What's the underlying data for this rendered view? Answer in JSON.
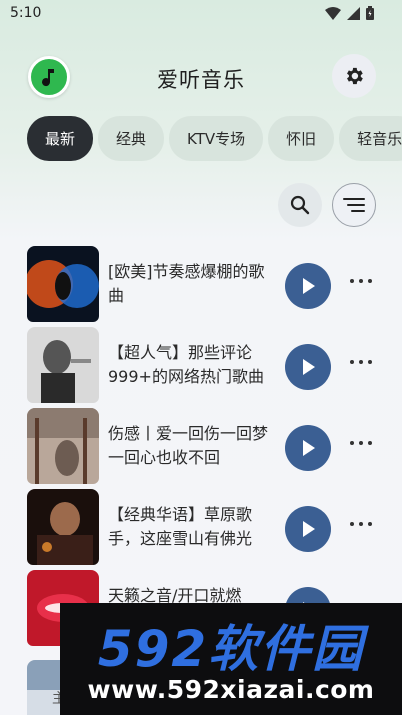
{
  "status_bar": {
    "time": "5:10",
    "icons": [
      "wifi-icon",
      "signal-icon",
      "battery-icon"
    ]
  },
  "header": {
    "title": "爱听音乐",
    "logo_icon": "music-note-icon",
    "settings_icon": "gear-icon"
  },
  "tabs": [
    {
      "label": "最新",
      "active": true
    },
    {
      "label": "经典",
      "active": false
    },
    {
      "label": "KTV专场",
      "active": false
    },
    {
      "label": "怀旧",
      "active": false
    },
    {
      "label": "轻音乐",
      "active": false
    }
  ],
  "tools": {
    "search_icon": "search-icon",
    "filter_icon": "filter-lines-icon"
  },
  "playlists": [
    {
      "title": "[欧美]节奏感爆棚的歌曲"
    },
    {
      "title": "【超人气】那些评论999+的网络热门歌曲"
    },
    {
      "title": "伤感丨爱一回伤一回梦一回心也收不回"
    },
    {
      "title": "【经典华语】草原歌手，这座雪山有佛光"
    },
    {
      "title": "天籁之音/开口就燃"
    }
  ],
  "partial_item_label": "主",
  "watermark": {
    "brand": "592软件园",
    "url": "www.592xiazai.com"
  },
  "colors": {
    "accent_play": "#3b5f93",
    "logo_green": "#2fb84f",
    "active_tab": "#2a2e33"
  }
}
